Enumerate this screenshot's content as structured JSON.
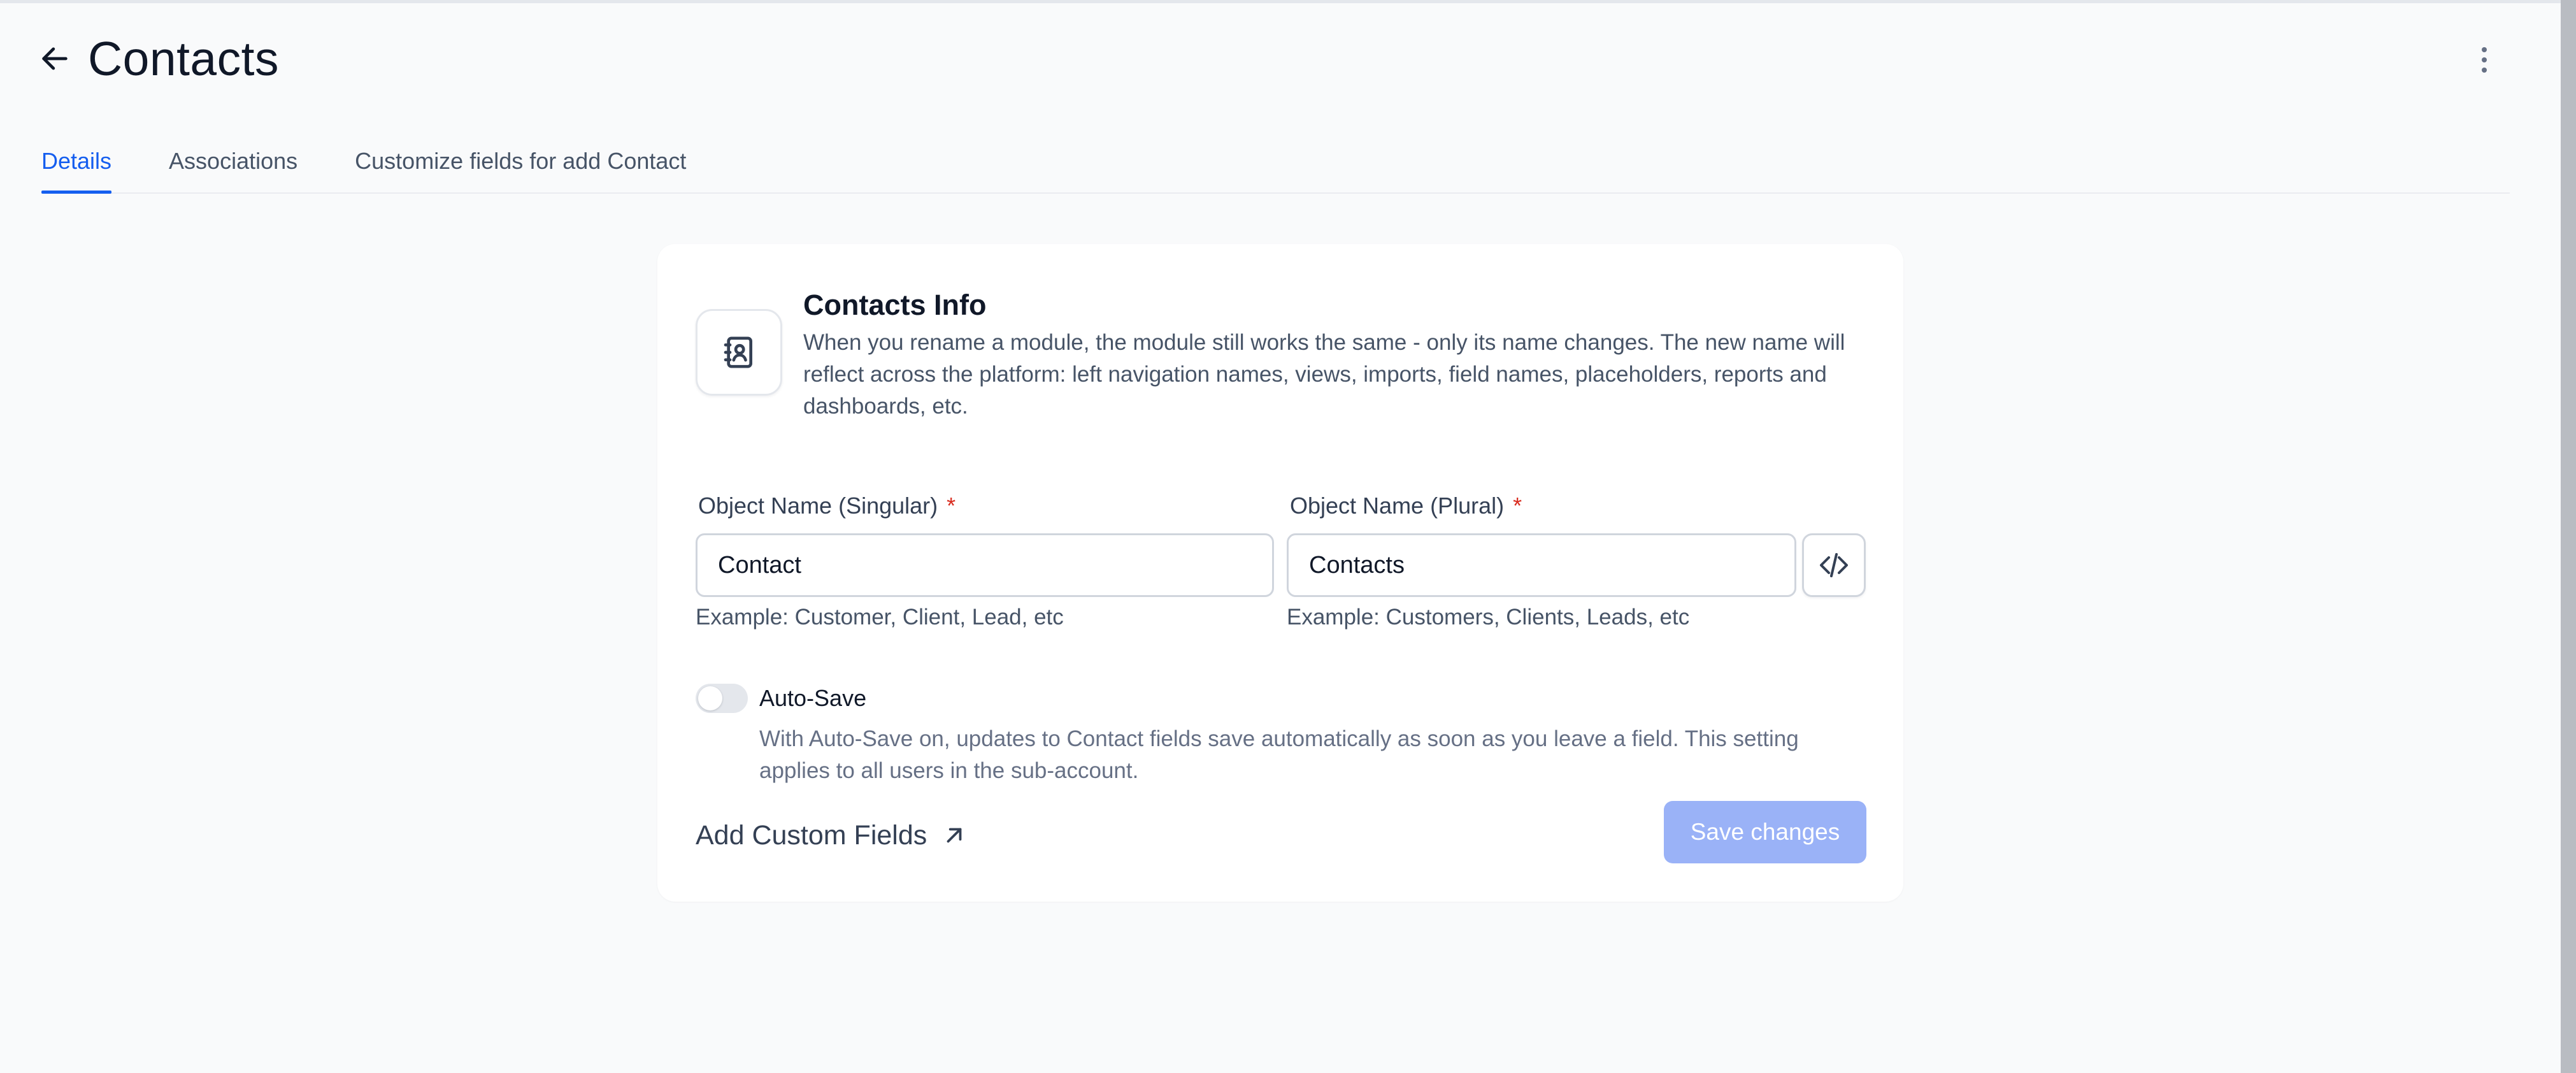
{
  "header": {
    "title": "Contacts",
    "back_icon": "arrow-left-icon",
    "menu_icon": "kebab-vertical-icon"
  },
  "tabs": [
    {
      "label": "Details",
      "active": true
    },
    {
      "label": "Associations",
      "active": false
    },
    {
      "label": "Customize fields for add Contact",
      "active": false
    }
  ],
  "info": {
    "icon": "contact-book-icon",
    "title": "Contacts Info",
    "description": "When you rename a module, the module still works the same - only its name changes. The new name will reflect across the platform: left navigation names, views, imports, field names, placeholders, reports and dashboards, etc."
  },
  "fields": {
    "singular": {
      "label": "Object Name (Singular)",
      "required_mark": "*",
      "value": "Contact",
      "hint": "Example: Customer, Client, Lead, etc"
    },
    "plural": {
      "label": "Object Name (Plural)",
      "required_mark": "*",
      "value": "Contacts",
      "hint": "Example: Customers, Clients, Leads, etc"
    },
    "code_icon": "code-icon"
  },
  "autosave": {
    "label": "Auto-Save",
    "enabled": false,
    "description": "With Auto-Save on, updates to Contact fields save automatically as soon as you leave a field. This setting applies to all users in the sub-account."
  },
  "footer": {
    "custom_fields_label": "Add Custom Fields",
    "custom_fields_icon": "arrow-up-right-icon",
    "save_label": "Save changes"
  },
  "colors": {
    "accent": "#155eef",
    "save_button_disabled": "#9ab2f7",
    "required": "#d92d20",
    "background": "#f9fafb"
  }
}
